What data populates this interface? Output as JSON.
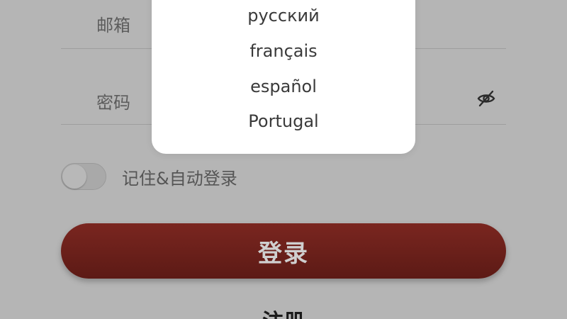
{
  "form": {
    "email_label": "邮箱",
    "password_label": "密码",
    "password_toggle_icon": "eye-slash-icon",
    "remember_label": "记住&自动登录",
    "remember_enabled": false,
    "login_label": "登录",
    "register_label": "注册"
  },
  "language_menu": {
    "options": [
      "русский",
      "français",
      "español",
      "Portugal"
    ]
  },
  "colors": {
    "overlay_background": "#b5b5b5",
    "login_button": "#6b2019",
    "popup_background": "#ffffff"
  }
}
